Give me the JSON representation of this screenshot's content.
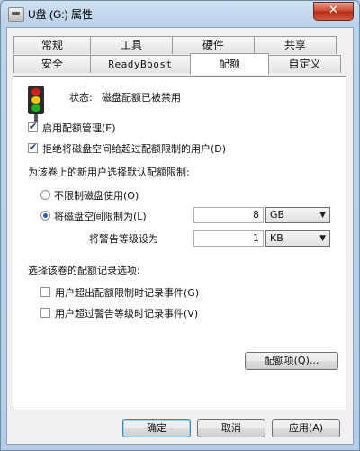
{
  "window": {
    "title": "U盘 (G:) 属性",
    "close_label": "✕"
  },
  "tabs_row1": [
    "常规",
    "工具",
    "硬件",
    "共享"
  ],
  "tabs_row2": [
    "安全",
    "ReadyBoost",
    "配额",
    "自定义"
  ],
  "active_tab": "配额",
  "quota": {
    "status_label": "状态:",
    "status_value": "磁盘配额已被禁用",
    "enable_quota": {
      "label": "启用配额管理(E)",
      "checked": true
    },
    "deny_space": {
      "label": "拒绝将磁盘空间给超过配额限制的用户(D)",
      "checked": true
    },
    "defaults_heading": "为该卷上的新用户选择默认配额限制:",
    "no_limit": {
      "label": "不限制磁盘使用(O)",
      "selected": false
    },
    "limit_to": {
      "label": "将磁盘空间限制为(L)",
      "selected": true,
      "value": "8",
      "unit": "GB"
    },
    "warning_level": {
      "label": "将警告等级设为",
      "value": "1",
      "unit": "KB"
    },
    "logging_heading": "选择该卷的配额记录选项:",
    "log_limit": {
      "label": "用户超出配额限制时记录事件(G)",
      "checked": false
    },
    "log_warning": {
      "label": "用户超过警告等级时记录事件(V)",
      "checked": false
    },
    "entries_button": "配额项(Q)..."
  },
  "buttons": {
    "ok": "确定",
    "cancel": "取消",
    "apply": "应用(A)"
  },
  "colors": {
    "light_red": "#d11c1c",
    "light_yellow": "#f2c400",
    "light_green": "#20b020"
  },
  "icons": {
    "traffic_light": "traffic-light-icon",
    "dropdown_arrow": "▼"
  }
}
